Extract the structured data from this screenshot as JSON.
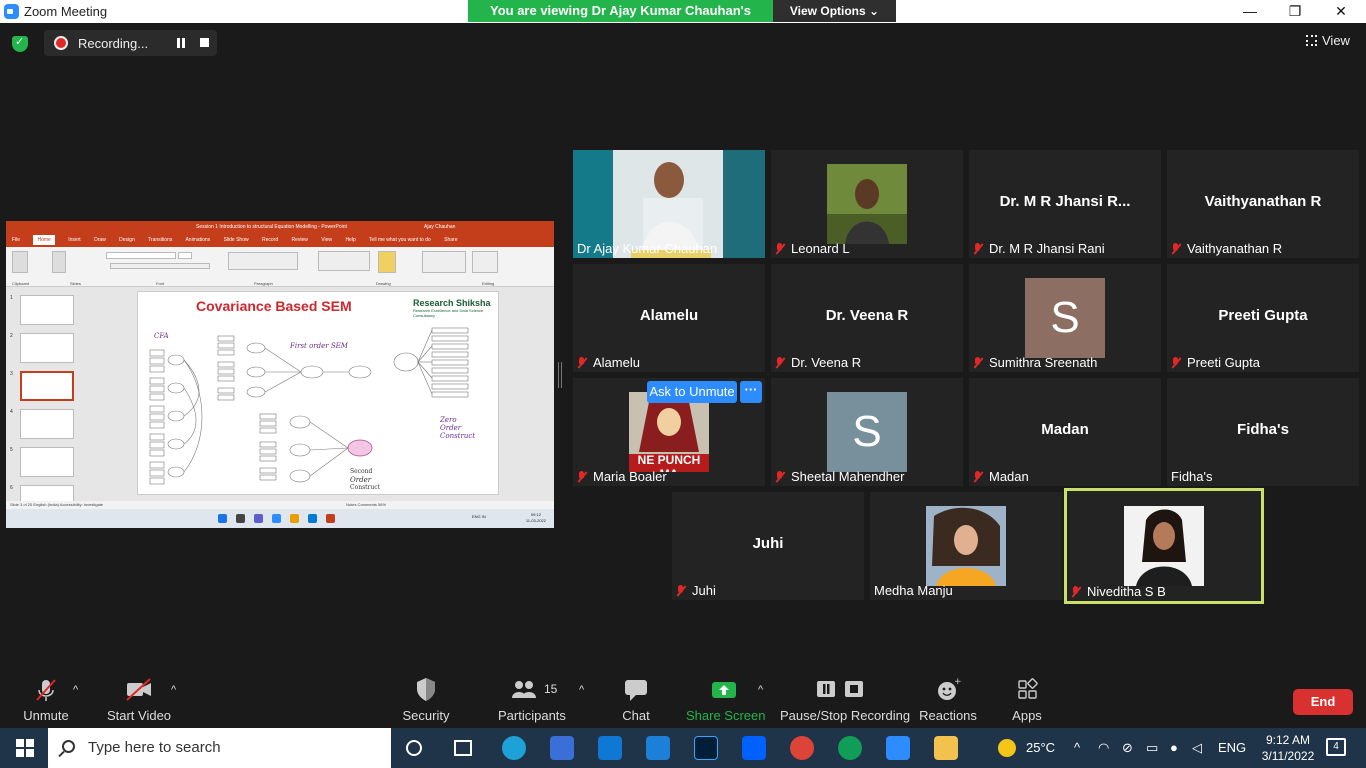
{
  "window": {
    "title": "Zoom Meeting",
    "banner": "You are viewing Dr Ajay Kumar Chauhan's screen",
    "view_options": "View Options",
    "recording": "Recording...",
    "view": "View"
  },
  "shared": {
    "ppt_title": "Session 1 Introduction to structural Equation Modelling  -  PowerPoint",
    "ppt_user": "Ajay Chauhan",
    "tabs": [
      "File",
      "Home",
      "Insert",
      "Draw",
      "Design",
      "Transitions",
      "Animations",
      "Slide Show",
      "Record",
      "Review",
      "View",
      "Help",
      "Tell me what you want to do",
      "Share"
    ],
    "groups": [
      "Clipboard",
      "Slides",
      "Font",
      "Paragraph",
      "Drawing",
      "Editing"
    ],
    "slide_title": "Covariance Based SEM",
    "brand": "Research Shiksha",
    "brand_sub": "Research Excellence and Data Science Consultancy",
    "label_cfa": "CFA",
    "label_first": "First order SEM",
    "label_zero1": "Zero",
    "label_zero2": "Order",
    "label_zero3": "Construct",
    "label_second1": "Second",
    "label_second2": "Order",
    "label_second3": "Construct",
    "status": "Slide 3 of 20     English (India)     Accessibility: Investigate",
    "status_right": "Notes   Comments   56%",
    "clock_time": "09:12",
    "clock_date": "11-03-2022",
    "lang": "ENG IN"
  },
  "participants": [
    {
      "name": "Dr Ajay Kumar Chauhan",
      "label": "",
      "muted": false,
      "type": "video"
    },
    {
      "name": "Leonard L",
      "label": "",
      "muted": true,
      "type": "photo"
    },
    {
      "name": "Dr. M R Jhansi Rani",
      "label": "Dr. M R Jhansi R...",
      "muted": true,
      "type": "text"
    },
    {
      "name": "Vaithyanathan R",
      "label": "Vaithyanathan R",
      "muted": true,
      "type": "text"
    },
    {
      "name": "Alamelu",
      "label": "Alamelu",
      "muted": true,
      "type": "text"
    },
    {
      "name": "Dr. Veena R",
      "label": "Dr. Veena R",
      "muted": true,
      "type": "text"
    },
    {
      "name": "Sumithra Sreenath",
      "label": "S",
      "muted": true,
      "type": "letter"
    },
    {
      "name": "Preeti Gupta",
      "label": "Preeti Gupta",
      "muted": true,
      "type": "text"
    },
    {
      "name": "Maria Boaler",
      "label": "NE PUNCH MA",
      "muted": true,
      "type": "photo"
    },
    {
      "name": "Sheetal Mahendher",
      "label": "S",
      "muted": true,
      "type": "letter"
    },
    {
      "name": "Madan",
      "label": "Madan",
      "muted": true,
      "type": "text"
    },
    {
      "name": "Fidha's",
      "label": "Fidha's",
      "muted": false,
      "type": "text"
    },
    {
      "name": "Juhi",
      "label": "Juhi",
      "muted": true,
      "type": "text"
    },
    {
      "name": "Medha Manju",
      "label": "",
      "muted": false,
      "type": "photo"
    },
    {
      "name": "Niveditha S B",
      "label": "",
      "muted": true,
      "type": "photo"
    }
  ],
  "ask_unmute": "Ask to Unmute",
  "more": "···",
  "toolbar": {
    "unmute": "Unmute",
    "start_video": "Start Video",
    "security": "Security",
    "participants": "Participants",
    "participants_count": "15",
    "chat": "Chat",
    "share_screen": "Share Screen",
    "pause_stop": "Pause/Stop Recording",
    "reactions": "Reactions",
    "apps": "Apps",
    "end": "End"
  },
  "taskbar": {
    "search_placeholder": "Type here to search",
    "temp": "25°C",
    "lang": "ENG",
    "time": "9:12 AM",
    "date": "3/11/2022",
    "notifications": "4"
  },
  "colors": {
    "zoom_blue": "#2d8cff",
    "banner_green": "#23b54c",
    "end_red": "#d93030",
    "ppt_red": "#c43e1c",
    "speaker_border": "#c8e06a",
    "mute_red": "#e02828"
  }
}
